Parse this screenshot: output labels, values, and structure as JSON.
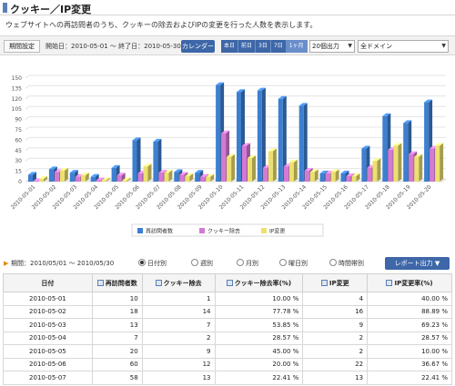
{
  "header": {
    "title": "クッキー／IP変更",
    "description": "ウェブサイトへの再訪問者のうち、クッキーの除去およびIPの変更を行った人数を表示します。"
  },
  "filter": {
    "period_label": "期間設定",
    "dates_text": "開始日：2010-05-01 ～ 終了日：2010-05-30",
    "calendar_label": "カレンダー",
    "ranges": [
      "本日",
      "前日",
      "3日",
      "7日",
      "1ヶ月"
    ],
    "active_range": "1ヶ月",
    "rows_select": "20個出力",
    "domain_select": "全ドメイン"
  },
  "colors": {
    "visitors": "#3d7fd0",
    "cookie": "#d479d4",
    "ip": "#ece070",
    "accent": "#3d67a8"
  },
  "chart_data": {
    "type": "bar",
    "style": "3d-grouped",
    "categories": [
      "2010-05-01",
      "2010-05-02",
      "2010-05-03",
      "2010-05-04",
      "2010-05-05",
      "2010-05-06",
      "2010-05-07",
      "2010-05-08",
      "2010-05-09",
      "2010-05-10",
      "2010-05-11",
      "2010-05-12",
      "2010-05-13",
      "2010-05-14",
      "2010-05-15",
      "2010-05-16",
      "2010-05-17",
      "2010-05-18",
      "2010-05-19",
      "2010-05-20"
    ],
    "series": [
      {
        "name": "再訪問者数",
        "values": [
          10,
          18,
          13,
          7,
          20,
          60,
          58,
          14,
          13,
          140,
          130,
          132,
          120,
          110,
          12,
          12,
          48,
          95,
          85,
          115
        ]
      },
      {
        "name": "クッキー除去",
        "values": [
          1,
          14,
          7,
          2,
          9,
          12,
          13,
          10,
          7,
          70,
          52,
          20,
          22,
          16,
          12,
          8,
          20,
          46,
          40,
          48
        ]
      },
      {
        "name": "IP変更",
        "values": [
          4,
          16,
          9,
          2,
          2,
          22,
          13,
          8,
          7,
          36,
          34,
          44,
          28,
          14,
          14,
          8,
          30,
          52,
          36,
          52
        ]
      }
    ],
    "yticks": [
      0,
      15,
      30,
      45,
      60,
      75,
      90,
      105,
      120,
      135,
      150
    ],
    "ylim": [
      0,
      150
    ],
    "legend_position": "bottom"
  },
  "period": {
    "text": "期間：2010/05/01 ～ 2010/05/30",
    "options": [
      "日付別",
      "週別",
      "月別",
      "曜日別",
      "時間帯別"
    ],
    "selected": "日付別",
    "report_button": "レポート出力"
  },
  "table": {
    "headers": [
      "日付",
      "再訪問者数",
      "クッキー除去",
      "クッキー除去率(%)",
      "IP変更",
      "IP変更率(%)"
    ],
    "rows": [
      [
        "2010-05-01",
        "10",
        "1",
        "10.00 %",
        "4",
        "40.00 %"
      ],
      [
        "2010-05-02",
        "18",
        "14",
        "77.78 %",
        "16",
        "88.89 %"
      ],
      [
        "2010-05-03",
        "13",
        "7",
        "53.85 %",
        "9",
        "69.23 %"
      ],
      [
        "2010-05-04",
        "7",
        "2",
        "28.57 %",
        "2",
        "28.57 %"
      ],
      [
        "2010-05-05",
        "20",
        "9",
        "45.00 %",
        "2",
        "10.00 %"
      ],
      [
        "2010-05-06",
        "60",
        "12",
        "20.00 %",
        "22",
        "36.67 %"
      ],
      [
        "2010-05-07",
        "58",
        "13",
        "22.41 %",
        "13",
        "22.41 %"
      ]
    ]
  }
}
